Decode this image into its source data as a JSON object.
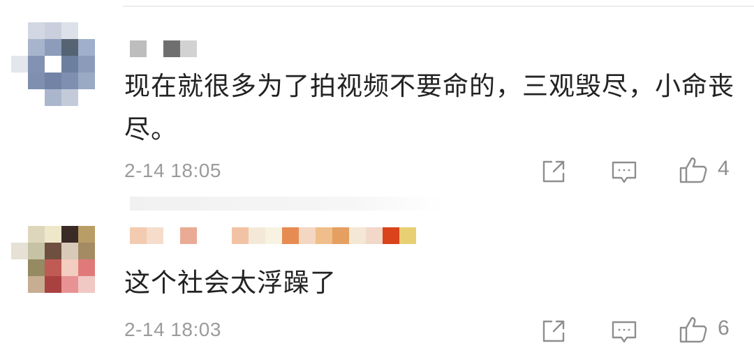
{
  "comments": [
    {
      "text": "现在就很多为了拍视频不要命的，三观毁尽，小命丧尽。",
      "timestamp": "2-14 18:05",
      "likes": "4",
      "actions": {
        "share_icon": "share-icon",
        "reply_icon": "reply-icon",
        "like_icon": "thumbs-up-icon"
      }
    },
    {
      "text": "这个社会太浮躁了",
      "timestamp": "2-14 18:03",
      "likes": "6",
      "actions": {
        "share_icon": "share-icon",
        "reply_icon": "reply-icon",
        "like_icon": "thumbs-up-icon"
      }
    }
  ],
  "colors": {
    "text": "#222222",
    "meta": "#9b9b9b",
    "icon": "#8e8e8e",
    "divider": "#ececec"
  }
}
